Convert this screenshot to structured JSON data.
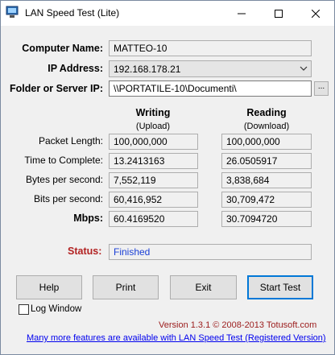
{
  "window": {
    "title": "LAN Speed Test (Lite)"
  },
  "form": {
    "computer_name_label": "Computer Name:",
    "computer_name": "MATTEO-10",
    "ip_label": "IP Address:",
    "ip_value": "192.168.178.21",
    "folder_label": "Folder or Server IP:",
    "folder_value": "\\\\PORTATILE-10\\Documenti\\",
    "browse_label": "..."
  },
  "results": {
    "writing_header": "Writing",
    "writing_sub": "(Upload)",
    "reading_header": "Reading",
    "reading_sub": "(Download)",
    "rows": [
      {
        "label": "Packet Length:",
        "write": "100,000,000",
        "read": "100,000,000"
      },
      {
        "label": "Time to Complete:",
        "write": "13.2413163",
        "read": "26.0505917"
      },
      {
        "label": "Bytes per second:",
        "write": "7,552,119",
        "read": "3,838,684"
      },
      {
        "label": "Bits per second:",
        "write": "60,416,952",
        "read": "30,709,472"
      },
      {
        "label": "Mbps:",
        "write": "60.4169520",
        "read": "30.7094720"
      }
    ]
  },
  "status": {
    "label": "Status:",
    "value": "Finished",
    "value_color": "#1a3fd6"
  },
  "buttons": {
    "help": "Help",
    "print": "Print",
    "exit": "Exit",
    "start": "Start Test"
  },
  "log_window_label": "Log Window",
  "version_text": "Version 1.3.1 © 2008-2013 Totusoft.com",
  "upgrade_link": "Many more features are available with LAN Speed Test (Registered Version)",
  "colors": {
    "accent": "#0078d7",
    "status_label": "#b22222",
    "version": "#9b1b1b"
  }
}
